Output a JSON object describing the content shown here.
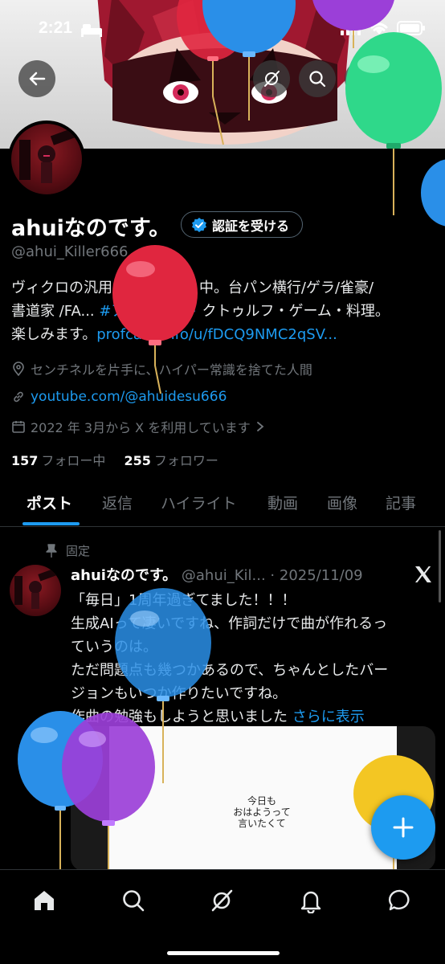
{
  "status_bar": {
    "time": "2:21"
  },
  "profile": {
    "name": "ahuiなのです。",
    "verify_label": "認証を受ける",
    "handle": "@ahui_Killer666",
    "bio_line1": "ヴィクロの汎用イレブン作り中。台パン横行/ゲラ/雀豪/",
    "bio_line2_a": "書道家 /FA... ",
    "bio_hashtag": "#アフィラスト",
    "bio_line2_b": " クトゥルフ・ゲーム・料理。",
    "bio_line3_a": "楽しみます。",
    "bio_link": "profcard.info/u/fDCQ9NMC2qSV...",
    "location": "センチネルを片手に、ハイパー常識を捨てた人間",
    "website": "youtube.com/@ahuidesu666",
    "joined": "2022 年 3月から X を利用しています",
    "following_count": "157",
    "following_label": "フォロー中",
    "followers_count": "255",
    "followers_label": "フォロワー"
  },
  "tabs": [
    {
      "label": "ポスト"
    },
    {
      "label": "返信"
    },
    {
      "label": "ハイライト"
    },
    {
      "label": "動画"
    },
    {
      "label": "画像"
    },
    {
      "label": "記事"
    }
  ],
  "post": {
    "pinned_label": "固定",
    "author": "ahuiなのです。",
    "meta": "@ahui_Kil... · 2025/11/09",
    "lines": [
      "「毎日」1周年過ぎてました！！！",
      "生成AIって凄いですね、作詞だけで曲が作れるっ",
      "ていうのは。",
      "ただ問題点も幾つかあるので、ちゃんとしたバー",
      "ジョンもいつか作りたいですね。"
    ],
    "last_line": "作曲の勉強もしようと思いました ",
    "show_more": "さらに表示",
    "media_text_1": "今日も",
    "media_text_2": "おはようって",
    "media_text_3": "言いたくて"
  },
  "colors": {
    "accent": "#1d9bf0",
    "muted": "#71767b",
    "background": "#000000"
  },
  "icons": {
    "back": "arrow-left-icon",
    "grok": "grok-icon",
    "search": "search-icon",
    "edit": "pencil-icon",
    "share": "share-icon",
    "verified": "verified-badge-icon",
    "location": "location-pin-icon",
    "link": "link-icon",
    "calendar": "calendar-icon",
    "pin": "pin-icon",
    "x_logo": "x-logo-icon",
    "compose": "plus-icon",
    "nav": [
      "home-icon",
      "search-icon",
      "grok-icon",
      "bell-icon",
      "message-icon"
    ]
  }
}
